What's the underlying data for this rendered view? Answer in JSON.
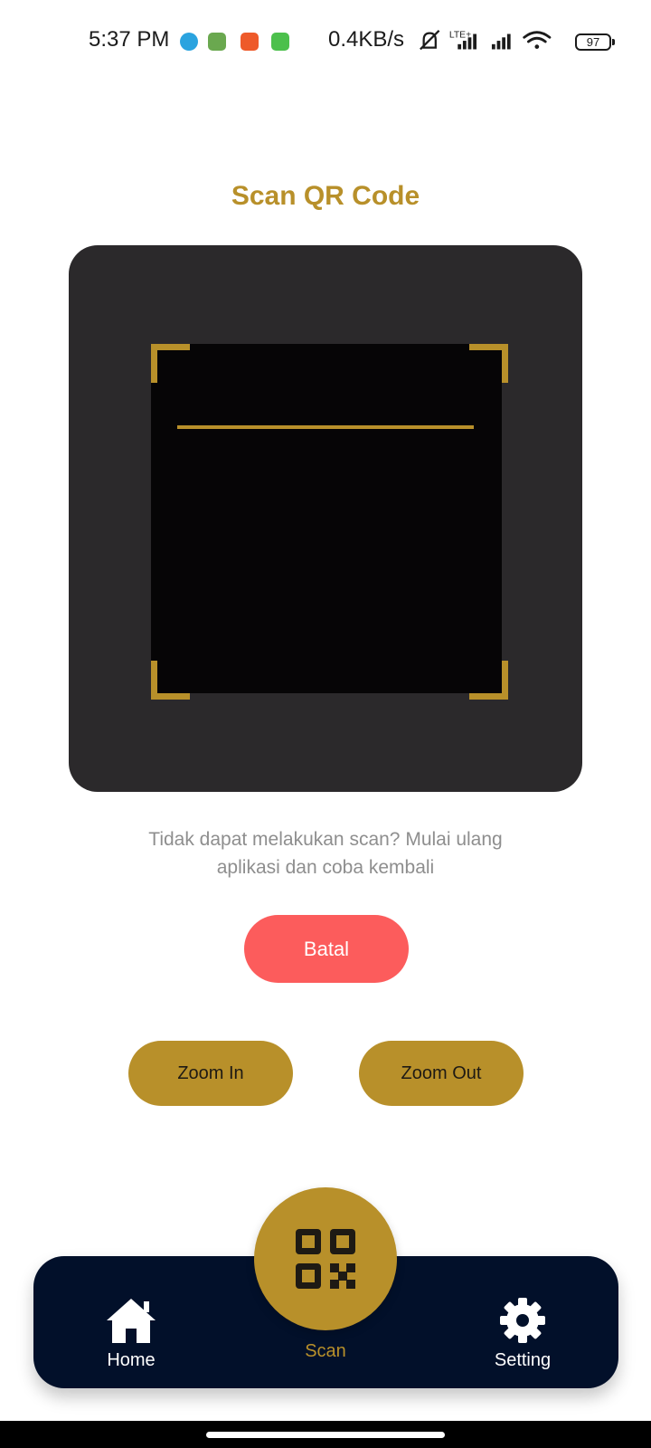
{
  "status_bar": {
    "time": "5:37 PM",
    "network_speed": "0.4KB/s",
    "lte_label": "LTE+",
    "battery": "97",
    "icons": [
      "telegram-icon",
      "game-app-icon",
      "shopee-icon",
      "android-app-icon",
      "mute-icon",
      "signal-icon",
      "signal-icon",
      "wifi-icon"
    ]
  },
  "page": {
    "title": "Scan QR Code",
    "hint": "Tidak dapat melakukan scan? Mulai ulang aplikasi dan coba kembali"
  },
  "buttons": {
    "cancel": "Batal",
    "zoom_in": "Zoom In",
    "zoom_out": "Zoom Out"
  },
  "nav": {
    "home": "Home",
    "scan": "Scan",
    "setting": "Setting"
  },
  "colors": {
    "accent_gold": "#b8902a",
    "cancel_red": "#fc5c5c",
    "nav_bg": "#02102a",
    "card_bg": "#2b292b"
  }
}
